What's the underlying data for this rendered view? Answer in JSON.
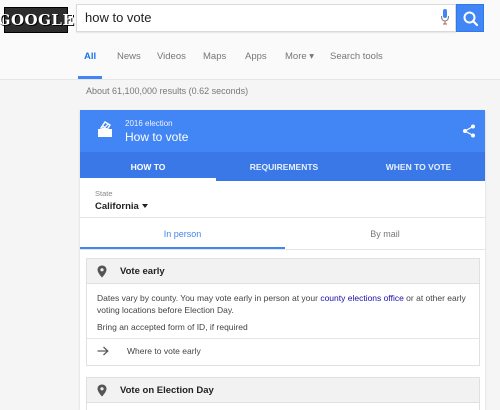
{
  "logo": {
    "text": "GOOGLE"
  },
  "search": {
    "query": "how to vote"
  },
  "tabs": [
    {
      "label": "All"
    },
    {
      "label": "News"
    },
    {
      "label": "Videos"
    },
    {
      "label": "Maps"
    },
    {
      "label": "Apps"
    },
    {
      "label": "More ▾"
    },
    {
      "label": "Search tools"
    }
  ],
  "stats": "About 61,100,000 results (0.62 seconds)",
  "card": {
    "subtitle": "2016 election",
    "title": "How to vote",
    "subtabs": [
      {
        "label": "HOW TO"
      },
      {
        "label": "REQUIREMENTS"
      },
      {
        "label": "WHEN TO VOTE"
      }
    ],
    "state_label": "State",
    "state_value": "California",
    "modes": [
      {
        "label": "In person"
      },
      {
        "label": "By mail"
      }
    ],
    "sections": [
      {
        "title": "Vote early",
        "text_before": "Dates vary by county. You may vote early in person at your ",
        "link": "county elections office",
        "text_after": " or at other early voting locations before Election Day.",
        "text2": "Bring an accepted form of ID, if required",
        "action": "Where to vote early"
      },
      {
        "title": "Vote on Election Day"
      }
    ]
  },
  "colors": {
    "accent": "#4285f4",
    "accent_dark": "#3b78e7",
    "link": "#1a0dab"
  }
}
